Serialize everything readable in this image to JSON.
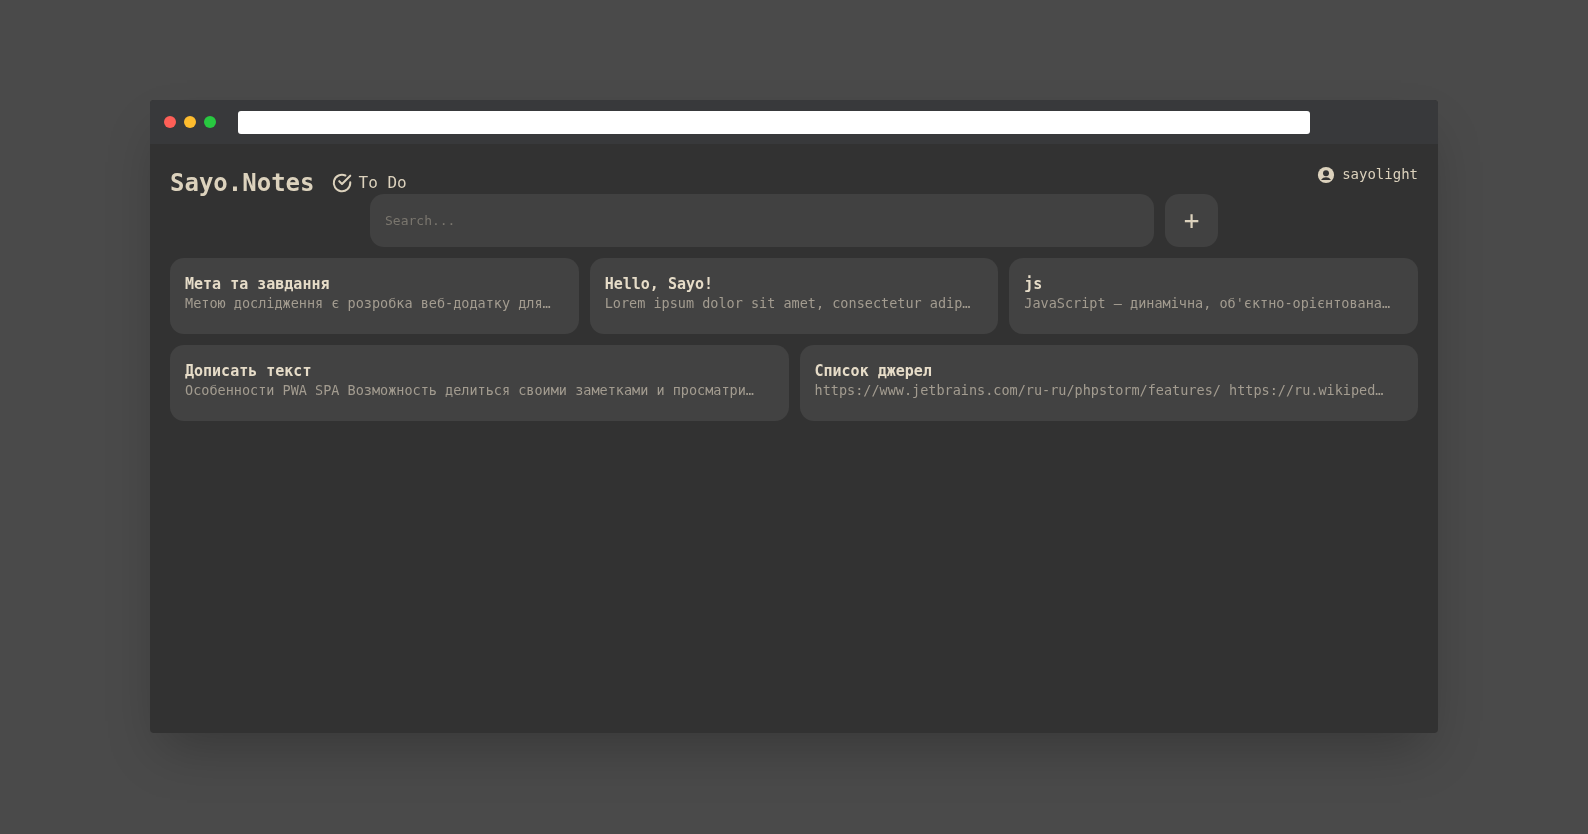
{
  "app": {
    "brand": "Sayo.Notes",
    "todo_link": "To Do",
    "user": "sayolight"
  },
  "search": {
    "placeholder": "Search...",
    "add_button": "+"
  },
  "note_rows": [
    [
      {
        "title": "Мета та завдання",
        "preview": "Метою дослідження є розробка веб-додатку для…"
      },
      {
        "title": "Hello, Sayo!",
        "preview": "Lorem ipsum dolor sit amet, consectetur adip…"
      },
      {
        "title": "js",
        "preview": "JavaScript — динамічна, об'єктно-орієнтована…"
      }
    ],
    [
      {
        "title": "Дописать текст",
        "preview": "Особенности PWA SPA Возможность делиться своими заметками и просматри…"
      },
      {
        "title": "Список джерел",
        "preview": "https://www.jetbrains.com/ru-ru/phpstorm/features/ https://ru.wikiped…"
      }
    ]
  ]
}
